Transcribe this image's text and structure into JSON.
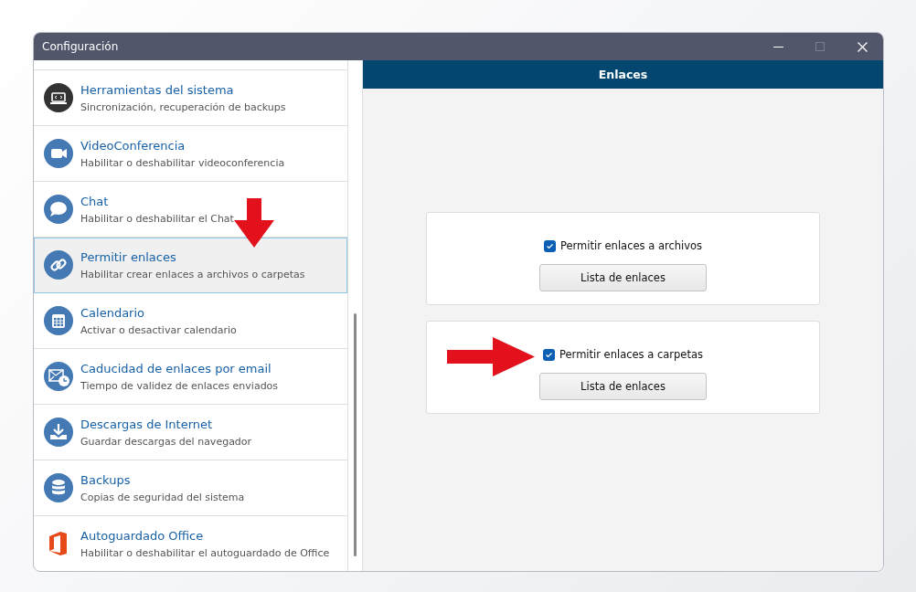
{
  "window": {
    "title": "Configuración"
  },
  "sidebar": {
    "items": [
      {
        "kind": "system-tools",
        "title": "Herramientas del sistema",
        "subtitle": "Sincronización, recuperación de backups",
        "selected": false
      },
      {
        "kind": "video",
        "title": "VideoConferencia",
        "subtitle": "Habilitar o deshabilitar videoconferencia",
        "selected": false
      },
      {
        "kind": "chat",
        "title": "Chat",
        "subtitle": "Habilitar o deshabilitar el Chat",
        "selected": false
      },
      {
        "kind": "link",
        "title": "Permitir enlaces",
        "subtitle": "Habilitar crear enlaces a archivos o carpetas",
        "selected": true
      },
      {
        "kind": "calendar",
        "title": "Calendario",
        "subtitle": "Activar o desactivar calendario",
        "selected": false
      },
      {
        "kind": "mail-clock",
        "title": "Caducidad de enlaces por email",
        "subtitle": "Tiempo de validez de enlaces enviados",
        "selected": false
      },
      {
        "kind": "download",
        "title": "Descargas de Internet",
        "subtitle": "Guardar descargas del navegador",
        "selected": false
      },
      {
        "kind": "database",
        "title": "Backups",
        "subtitle": "Copias de seguridad del sistema",
        "selected": false
      },
      {
        "kind": "office",
        "title": "Autoguardado Office",
        "subtitle": "Habilitar o deshabilitar el autoguardado de Office",
        "selected": false
      }
    ]
  },
  "panel": {
    "title": "Enlaces",
    "cards": [
      {
        "checkbox": {
          "label": "Permitir enlaces a archivos",
          "checked": true
        },
        "button": "Lista de enlaces"
      },
      {
        "checkbox": {
          "label": "Permitir enlaces a carpetas",
          "checked": true
        },
        "button": "Lista de enlaces"
      }
    ]
  }
}
